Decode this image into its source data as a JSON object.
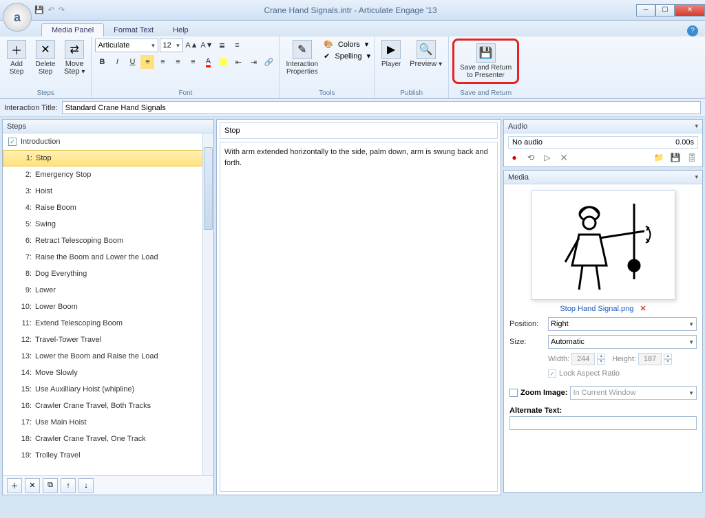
{
  "window": {
    "title": "Crane Hand Signals.intr  -  Articulate Engage '13"
  },
  "tabs": {
    "media_panel": "Media Panel",
    "format_text": "Format Text",
    "help": "Help"
  },
  "ribbon": {
    "steps_group": "Steps",
    "add_step": "Add\nStep",
    "delete_step": "Delete\nStep",
    "move_step": "Move\nStep",
    "font_group": "Font",
    "font_name": "Articulate",
    "font_size": "12",
    "tools_group": "Tools",
    "interaction_properties": "Interaction\nProperties",
    "colors": "Colors",
    "spelling": "Spelling",
    "publish_group": "Publish",
    "player": "Player",
    "preview": "Preview",
    "save_return_group": "Save and Return",
    "save_return": "Save and Return\nto Presenter"
  },
  "interaction_title_label": "Interaction Title:",
  "interaction_title_value": "Standard Crane Hand Signals",
  "steps_header": "Steps",
  "intro_label": "Introduction",
  "steps": [
    {
      "n": "1:",
      "t": "Stop"
    },
    {
      "n": "2:",
      "t": "Emergency Stop"
    },
    {
      "n": "3:",
      "t": "Hoist"
    },
    {
      "n": "4:",
      "t": "Raise Boom"
    },
    {
      "n": "5:",
      "t": "Swing"
    },
    {
      "n": "6:",
      "t": "Retract Telescoping Boom"
    },
    {
      "n": "7:",
      "t": "Raise the Boom and Lower the Load"
    },
    {
      "n": "8:",
      "t": "Dog Everything"
    },
    {
      "n": "9:",
      "t": "Lower"
    },
    {
      "n": "10:",
      "t": "Lower Boom"
    },
    {
      "n": "11:",
      "t": "Extend Telescoping Boom"
    },
    {
      "n": "12:",
      "t": "Travel-Tower Travel"
    },
    {
      "n": "13:",
      "t": "Lower the Boom and Raise the Load"
    },
    {
      "n": "14:",
      "t": "Move Slowly"
    },
    {
      "n": "15:",
      "t": "Use Auxilliary Hoist (whipline)"
    },
    {
      "n": "16:",
      "t": "Crawler Crane Travel, Both Tracks"
    },
    {
      "n": "17:",
      "t": "Use Main Hoist"
    },
    {
      "n": "18:",
      "t": "Crawler Crane Travel, One Track"
    },
    {
      "n": "19:",
      "t": "Trolley Travel"
    }
  ],
  "editor": {
    "title": "Stop",
    "body": "With arm extended horizontally to the side, palm down, arm is swung back and forth."
  },
  "audio": {
    "header": "Audio",
    "status": "No audio",
    "time": "0.00s"
  },
  "media": {
    "header": "Media",
    "filename": "Stop Hand Signal.png",
    "position_label": "Position:",
    "position_value": "Right",
    "size_label": "Size:",
    "size_value": "Automatic",
    "width_label": "Width:",
    "width_value": "244",
    "height_label": "Height:",
    "height_value": "187",
    "lock_label": "Lock Aspect Ratio",
    "zoom_label": "Zoom Image:",
    "zoom_value": "In Current Window",
    "alt_label": "Alternate Text:"
  }
}
